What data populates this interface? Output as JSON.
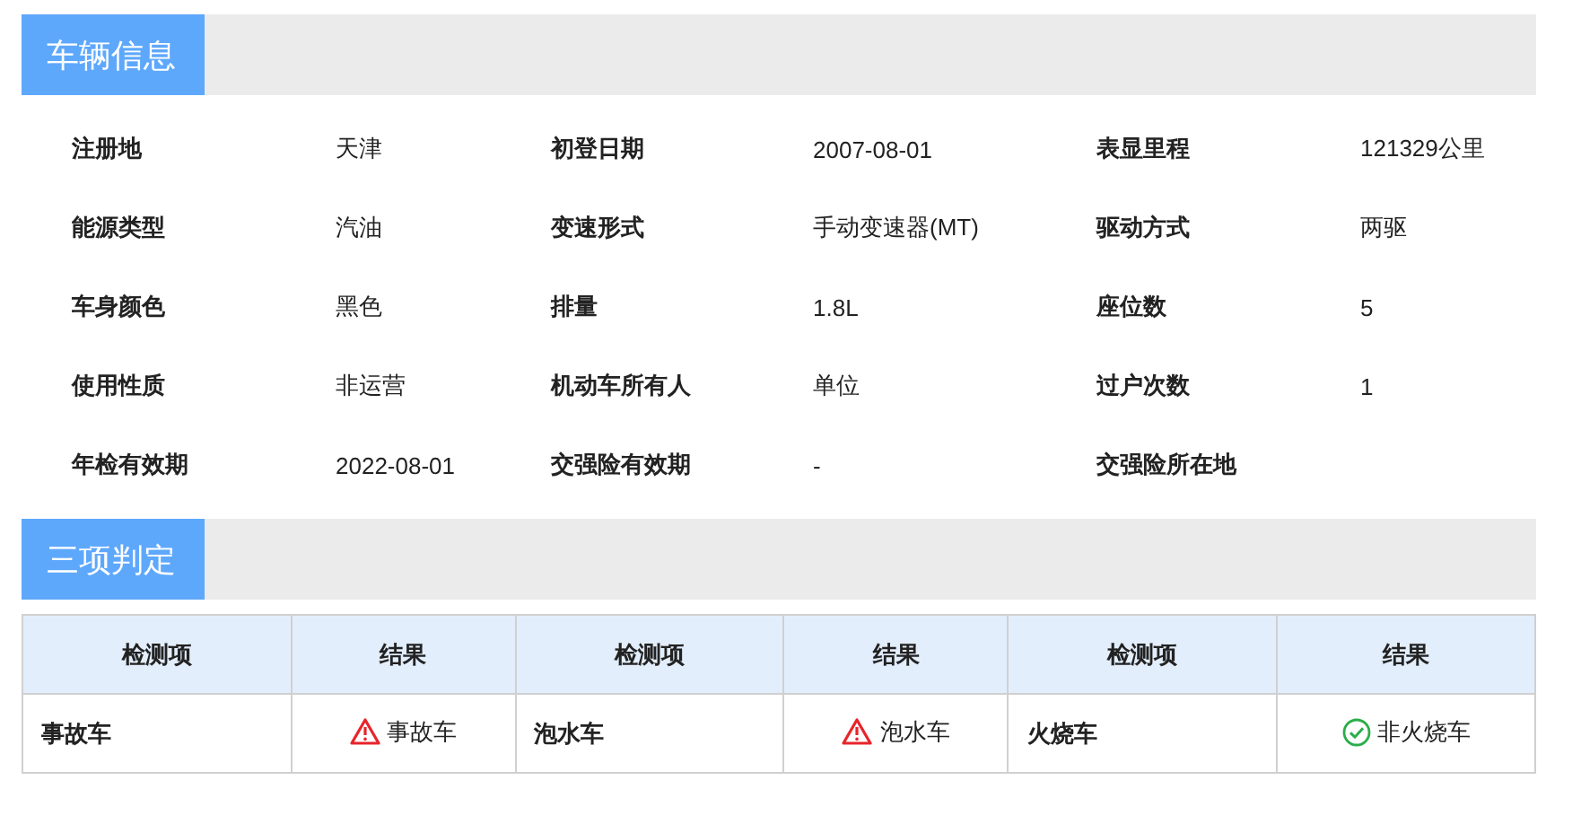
{
  "vehicle_info": {
    "title": "车辆信息",
    "fields": [
      {
        "label": "注册地",
        "value": "天津"
      },
      {
        "label": "初登日期",
        "value": "2007-08-01"
      },
      {
        "label": "表显里程",
        "value": "121329公里"
      },
      {
        "label": "能源类型",
        "value": "汽油"
      },
      {
        "label": "变速形式",
        "value": "手动变速器(MT)"
      },
      {
        "label": "驱动方式",
        "value": "两驱"
      },
      {
        "label": "车身颜色",
        "value": "黑色"
      },
      {
        "label": "排量",
        "value": "1.8L"
      },
      {
        "label": "座位数",
        "value": "5"
      },
      {
        "label": "使用性质",
        "value": "非运营"
      },
      {
        "label": "机动车所有人",
        "value": "单位"
      },
      {
        "label": "过户次数",
        "value": "1"
      },
      {
        "label": "年检有效期",
        "value": "2022-08-01"
      },
      {
        "label": "交强险有效期",
        "value": "-"
      },
      {
        "label": "交强险所在地"
      }
    ]
  },
  "inspection": {
    "title": "三项判定",
    "columns": [
      "检测项",
      "结果",
      "检测项",
      "结果",
      "检测项",
      "结果"
    ],
    "items": [
      {
        "item": "事故车",
        "result": "事故车",
        "kind": "warning"
      },
      {
        "item": "泡水车",
        "result": "泡水车",
        "kind": "warning"
      },
      {
        "item": "火烧车",
        "result": "非火烧车",
        "kind": "ok"
      }
    ]
  }
}
